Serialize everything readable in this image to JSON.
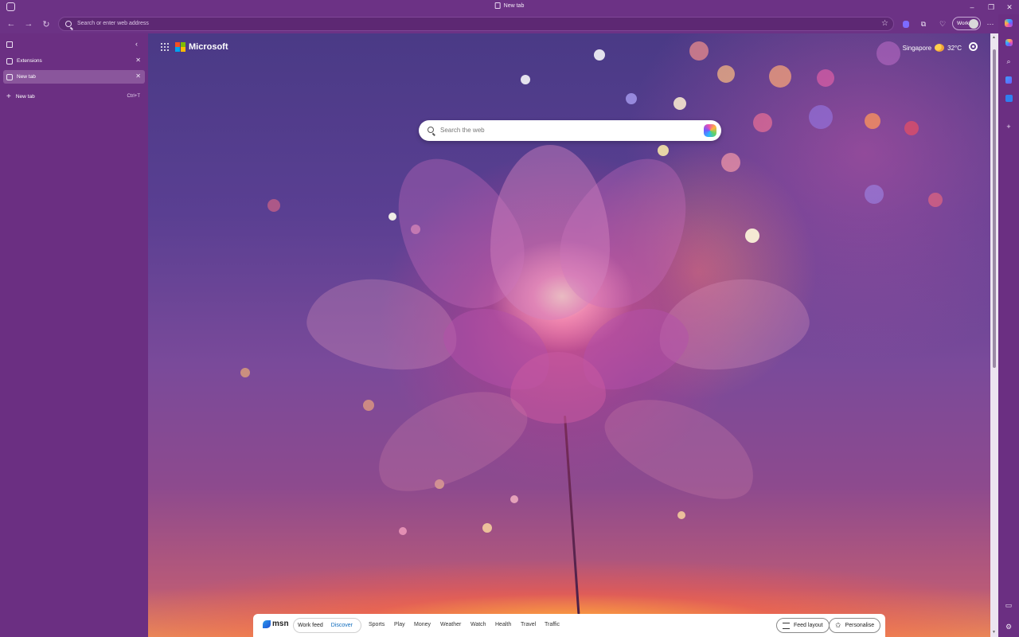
{
  "window": {
    "tab_title": "New tab",
    "controls": {
      "minimize": "–",
      "restore": "❐",
      "close": "✕"
    }
  },
  "toolbar": {
    "address_placeholder": "Search or enter web address",
    "profile_label": "Work"
  },
  "sidebar": {
    "tabs": [
      {
        "label": "Extensions",
        "icon": "puzzle-icon",
        "active": false
      },
      {
        "label": "New tab",
        "icon": "page-icon",
        "active": true
      }
    ],
    "new_tab_label": "New tab",
    "new_tab_shortcut": "Ctrl+T"
  },
  "newtab_page": {
    "brand": "Microsoft",
    "weather": {
      "city": "Singapore",
      "temperature": "32°C",
      "icon": "partly-sunny-icon"
    },
    "search_placeholder": "Search the web"
  },
  "msn_bar": {
    "logo_text": "msn",
    "feed_tabs": [
      {
        "label": "Work feed",
        "active": false
      },
      {
        "label": "Discover",
        "active": true
      }
    ],
    "categories": [
      "Sports",
      "Play",
      "Money",
      "Weather",
      "Watch",
      "Health",
      "Travel",
      "Traffic"
    ],
    "feed_layout_label": "Feed layout",
    "personalise_label": "Personalise"
  },
  "colors": {
    "browser_chrome": "#6c3285",
    "active_tab": "#8a569c",
    "link_blue": "#0f6cbd"
  }
}
